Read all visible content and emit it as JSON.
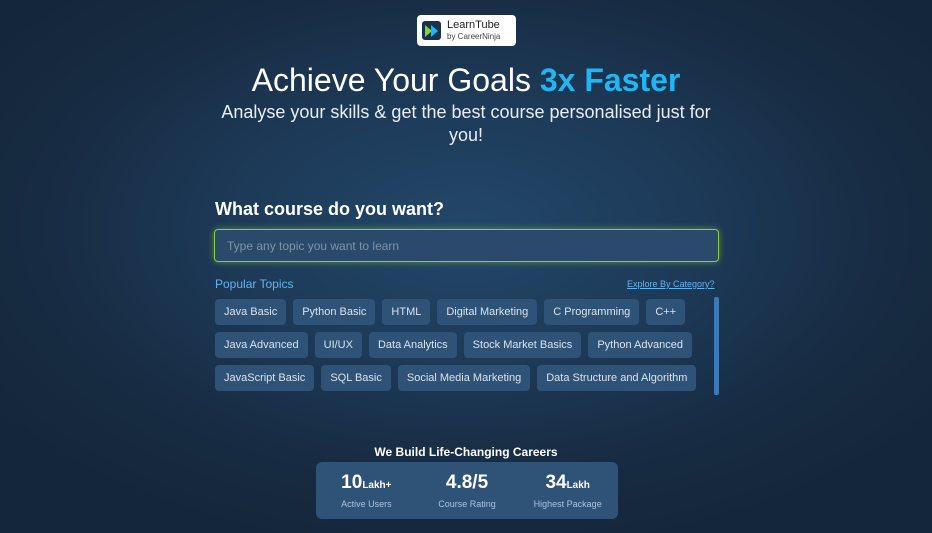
{
  "brand": {
    "name": "LearnTube",
    "sub": "by CareerNinja",
    "icon": "fast-forward-icon",
    "colors": {
      "mark_bg": "#17334f",
      "arrow1": "#8ad22d",
      "arrow2": "#1fb6f3"
    }
  },
  "hero": {
    "title_main": "Achieve Your Goals ",
    "title_accent": "3x Faster",
    "subtitle": "Analyse your skills & get the best course personalised just for you!"
  },
  "search": {
    "question": "What course do you want?",
    "value": "",
    "placeholder": "Type any topic you want to learn"
  },
  "topics": {
    "heading": "Popular Topics",
    "explore_link": "Explore By Category?",
    "items": [
      "Java Basic",
      "Python Basic",
      "HTML",
      "Digital Marketing",
      "C Programming",
      "C++",
      "Java Advanced",
      "UI/UX",
      "Data Analytics",
      "Stock Market Basics",
      "Python Advanced",
      "JavaScript Basic",
      "SQL Basic",
      "Social Media Marketing",
      "Data Structure and Algorithm"
    ]
  },
  "careers": {
    "title": "We Build Life-Changing Careers",
    "stats": [
      {
        "value": "10",
        "unit": "Lakh+",
        "label": "Active Users"
      },
      {
        "value": "4.8/5",
        "unit": "",
        "label": "Course Rating"
      },
      {
        "value": "34",
        "unit": "Lakh",
        "label": "Highest Package"
      }
    ]
  },
  "colors": {
    "accent": "#1fb6f3",
    "search_border": "#8ad22d",
    "chip_bg": "#2f5277",
    "link": "#63b3f0"
  }
}
